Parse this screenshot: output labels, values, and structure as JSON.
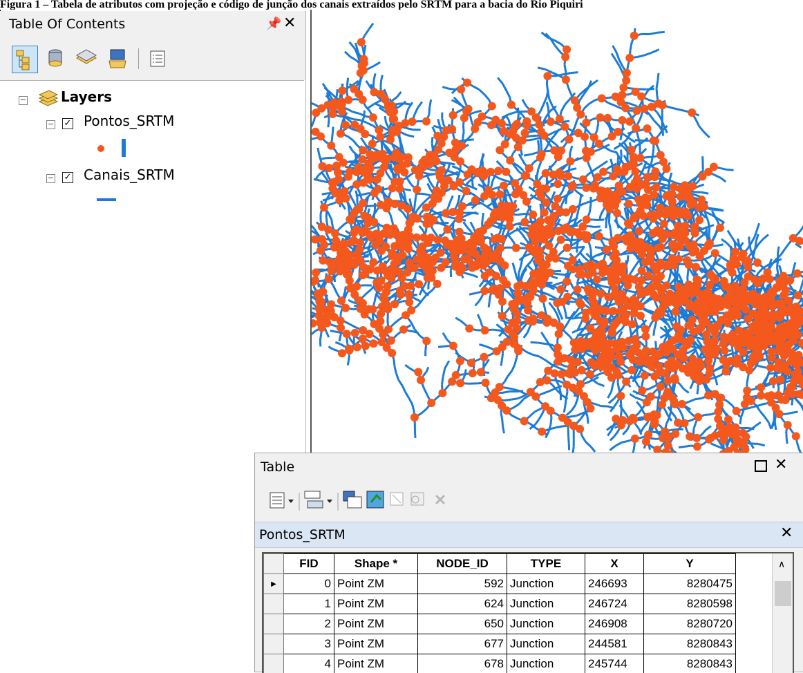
{
  "caption": "Figura 1 – Tabela de atributos com projeção e código de junção dos canais extraídos pelo SRTM para a bacia do Rio Piquiri",
  "toc": {
    "title": "Table Of Contents",
    "pin_glyph": "⨅",
    "close_glyph": "✕",
    "toolbar": [
      "list-by-drawing-order-icon",
      "list-by-source-icon",
      "list-by-visibility-icon",
      "list-by-selection-icon",
      "options-icon"
    ],
    "root_label": "Layers",
    "layers": [
      {
        "name": "Pontos_SRTM",
        "checked": true,
        "symbol": "point"
      },
      {
        "name": "Canais_SRTM",
        "checked": true,
        "symbol": "line"
      }
    ],
    "colors": {
      "points": "#f5581c",
      "lines": "#1c7bd6"
    }
  },
  "table": {
    "title": "Table",
    "tab_label": "Pontos_SRTM",
    "toolbar": [
      "table-options-icon",
      "related-tables-icon",
      "select-by-attributes-icon",
      "switch-selection-icon",
      "clear-selection-icon",
      "zoom-to-selected-icon",
      "delete-selected-icon"
    ],
    "columns": [
      "FID",
      "Shape *",
      "NODE_ID",
      "TYPE",
      "X",
      "Y"
    ],
    "rows": [
      {
        "fid": "0",
        "shape": "Point ZM",
        "node_id": "592",
        "type": "Junction",
        "x": "246693",
        "y": "8280475"
      },
      {
        "fid": "1",
        "shape": "Point ZM",
        "node_id": "624",
        "type": "Junction",
        "x": "246724",
        "y": "8280598"
      },
      {
        "fid": "2",
        "shape": "Point ZM",
        "node_id": "650",
        "type": "Junction",
        "x": "246908",
        "y": "8280720"
      },
      {
        "fid": "3",
        "shape": "Point ZM",
        "node_id": "677",
        "type": "Junction",
        "x": "244581",
        "y": "8280843"
      },
      {
        "fid": "4",
        "shape": "Point ZM",
        "node_id": "678",
        "type": "Junction",
        "x": "245744",
        "y": "8280843"
      }
    ]
  }
}
